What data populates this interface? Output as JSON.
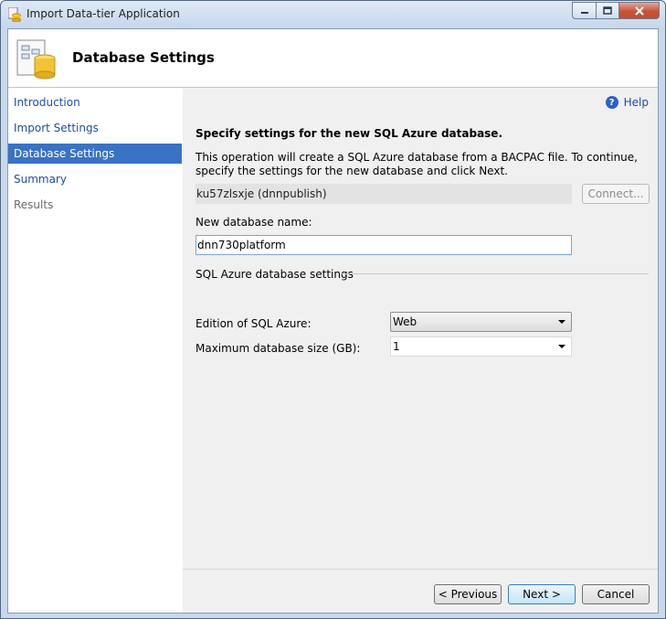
{
  "window": {
    "title": "Import Data-tier Application",
    "controls": {
      "minimize": "minimize",
      "maximize": "maximize",
      "close": "close"
    }
  },
  "header": {
    "title": "Database Settings"
  },
  "nav": {
    "items": [
      {
        "label": "Introduction",
        "state": "link"
      },
      {
        "label": "Import Settings",
        "state": "link"
      },
      {
        "label": "Database Settings",
        "state": "selected"
      },
      {
        "label": "Summary",
        "state": "link"
      },
      {
        "label": "Results",
        "state": "disabled"
      }
    ]
  },
  "content": {
    "help_label": "Help",
    "section_title": "Specify settings for the new SQL Azure database.",
    "description": "This operation will create a SQL Azure database from a BACPAC file. To continue, specify the settings for the new database and click Next.",
    "server": "ku57zlsxje (dnnpublish)",
    "connect_label": "Connect...",
    "new_db_label": "New database name:",
    "new_db_value": "dnn730platform",
    "group_label": "SQL Azure database settings",
    "edition_label": "Edition of SQL Azure:",
    "edition_value": "Web",
    "size_label": "Maximum database size (GB):",
    "size_value": "1"
  },
  "footer": {
    "previous_label": "< Previous",
    "next_label": "Next >",
    "cancel_label": "Cancel"
  },
  "colors": {
    "selected_nav": "#3a72c4",
    "link": "#1e4ea6"
  }
}
